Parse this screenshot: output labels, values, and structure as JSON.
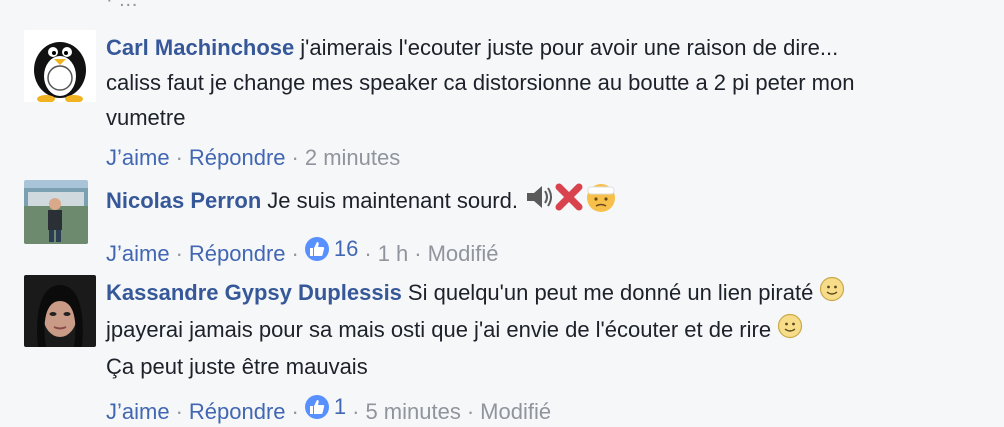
{
  "top_cut_text": "· …",
  "comments": [
    {
      "author": "Carl Machinchose",
      "lines": [
        "j'aimerais l'ecouter juste pour avoir une raison de dire...",
        "caliss faut je change mes speaker ca distorsionne au boutte a 2 pi peter mon",
        "vumetre"
      ],
      "like_label": "J’aime",
      "reply_label": "Répondre",
      "time": "2 minutes"
    },
    {
      "author": "Nicolas Perron",
      "text": "Je suis maintenant sourd.",
      "emojis": [
        "speaker-icon",
        "cross-icon",
        "injured-face-icon"
      ],
      "like_label": "J’aime",
      "reply_label": "Répondre",
      "likes": "16",
      "time": "1 h",
      "edited": "Modifié"
    },
    {
      "author": "Kassandre Gypsy Duplessis",
      "lines": [
        "Si quelqu'un peut me donné un lien piraté",
        "jpayerai jamais pour sa mais osti que j'ai envie de l'écouter et de rire",
        "Ça peut juste être mauvais"
      ],
      "like_label": "J’aime",
      "reply_label": "Répondre",
      "likes": "1",
      "time": "5 minutes",
      "edited": "Modifié"
    }
  ],
  "colors": {
    "author": "#365899",
    "link": "#4267b2",
    "meta": "#90949c",
    "like_badge": "#5890ff",
    "background": "#f6f7f9"
  }
}
